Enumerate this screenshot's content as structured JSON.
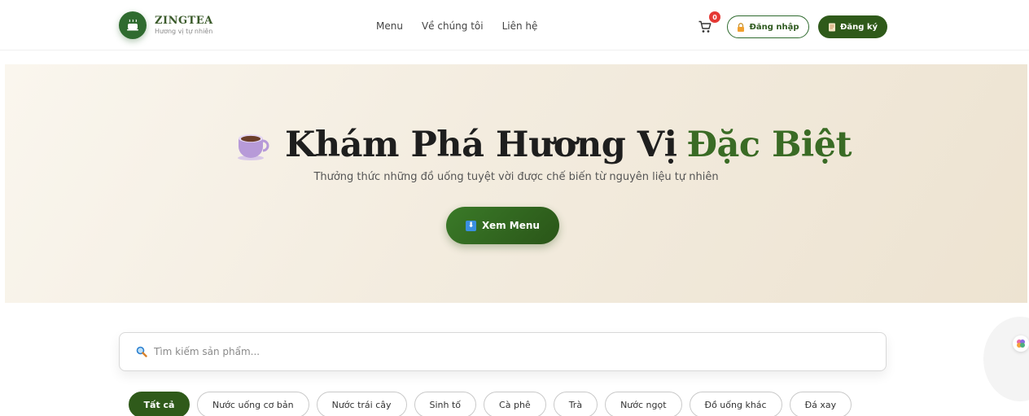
{
  "brand": {
    "name": "ZINGTEA",
    "tagline": "Hương vị tự nhiên"
  },
  "nav": {
    "items": [
      "Menu",
      "Về chúng tôi",
      "Liên hệ"
    ]
  },
  "cart": {
    "count": "0"
  },
  "auth": {
    "login_label": "Đăng nhập",
    "register_label": "Đăng ký"
  },
  "hero": {
    "title_main": "Khám Phá Hương Vị",
    "title_accent": "Đặc Biệt",
    "subtitle": "Thưởng thức những đồ uống tuyệt vời được chế biến từ nguyên liệu tự nhiên",
    "cta_label": "Xem Menu"
  },
  "search": {
    "placeholder": "Tìm kiếm sản phẩm..."
  },
  "categories": [
    "Tất cả",
    "Nước uống cơ bản",
    "Nước trái cây",
    "Sinh tố",
    "Cà phê",
    "Trà",
    "Nước ngọt",
    "Đồ uống khác",
    "Đá xay"
  ],
  "colors": {
    "brand_green": "#2f5a1a",
    "accent_green": "#3a6b25",
    "badge_red": "#e53935",
    "hero_bg": "#f3ecdf"
  },
  "icons": {
    "logo": "tea-cup-icon",
    "cart": "cart-icon",
    "login": "lock-icon",
    "register": "memo-icon",
    "cta": "download-arrow-icon",
    "search": "search-icon",
    "hero": "coffee-cup-icon"
  }
}
